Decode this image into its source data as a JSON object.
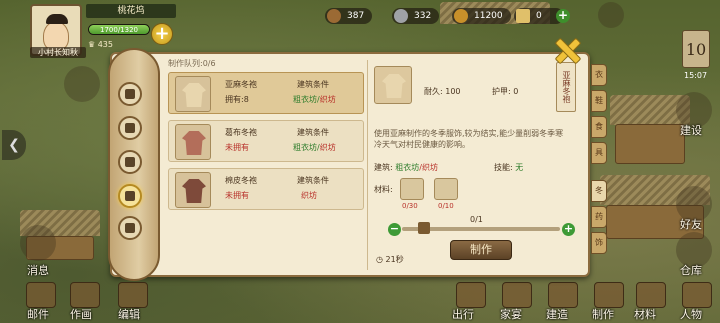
{
  "top": {
    "village_name": "桃花坞",
    "player_name": "小村长知秋",
    "population": "1700/1320",
    "population_fraction": 1.0,
    "prosperity": "435",
    "resources": [
      {
        "name": "wood",
        "value": "387",
        "icon": "log-icon",
        "color": "#9b6a34"
      },
      {
        "name": "stone",
        "value": "332",
        "icon": "stone-icon",
        "color": "#9fa2a6"
      },
      {
        "name": "coins",
        "value": "11200",
        "icon": "coin-icon",
        "color": "#c8902a"
      },
      {
        "name": "jade",
        "value": "0",
        "icon": "scroll-icon",
        "color": "#e0c06a"
      }
    ],
    "day": "10",
    "time": "15:07"
  },
  "panel": {
    "queue_label": "制作队列:0/6",
    "items": [
      {
        "name": "亚麻冬袍",
        "owned": "拥有:8",
        "cond_label": "建筑条件",
        "cond_a": "粗衣坊/",
        "cond_b": "织坊",
        "color": "#e8d6ae"
      },
      {
        "name": "葛布冬袍",
        "owned": "未拥有",
        "cond_label": "建筑条件",
        "cond_a": "粗衣坊/",
        "cond_b": "织坊",
        "color": "#b36e5a"
      },
      {
        "name": "棉皮冬袍",
        "owned": "未拥有",
        "cond_label": "建筑条件",
        "cond_a": "",
        "cond_b": "织坊",
        "color": "#7e4a3a"
      }
    ],
    "detail": {
      "durability_label": "耐久:",
      "durability": "100",
      "armor_label": "护甲:",
      "armor": "0",
      "tag": "亚麻冬袍",
      "description": "使用亚麻制作的冬季服饰,较为结实,能少量削弱冬季寒冷天气对村民健康的影响。",
      "building_label": "建筑:",
      "building_a": "粗衣坊",
      "building_b": "/织坊",
      "skill_label": "技能:",
      "skill": "无",
      "materials_label": "材料:",
      "materials": [
        {
          "icon": "linen-icon",
          "count": "0/30"
        },
        {
          "icon": "fabric-icon",
          "count": "0/10"
        }
      ],
      "quantity": "0/1",
      "make_label": "制作",
      "timer": "21秒"
    },
    "side_tabs": [
      "衣",
      "鞋",
      "食",
      "具",
      "冬",
      "药",
      "饰"
    ]
  },
  "nav": {
    "left": [
      "消息",
      "邮件",
      "作画",
      "编辑"
    ],
    "bottom": [
      "出行",
      "家宴",
      "建造",
      "制作",
      "材料",
      "人物"
    ],
    "right": [
      "建设",
      "好友",
      "仓库"
    ]
  }
}
